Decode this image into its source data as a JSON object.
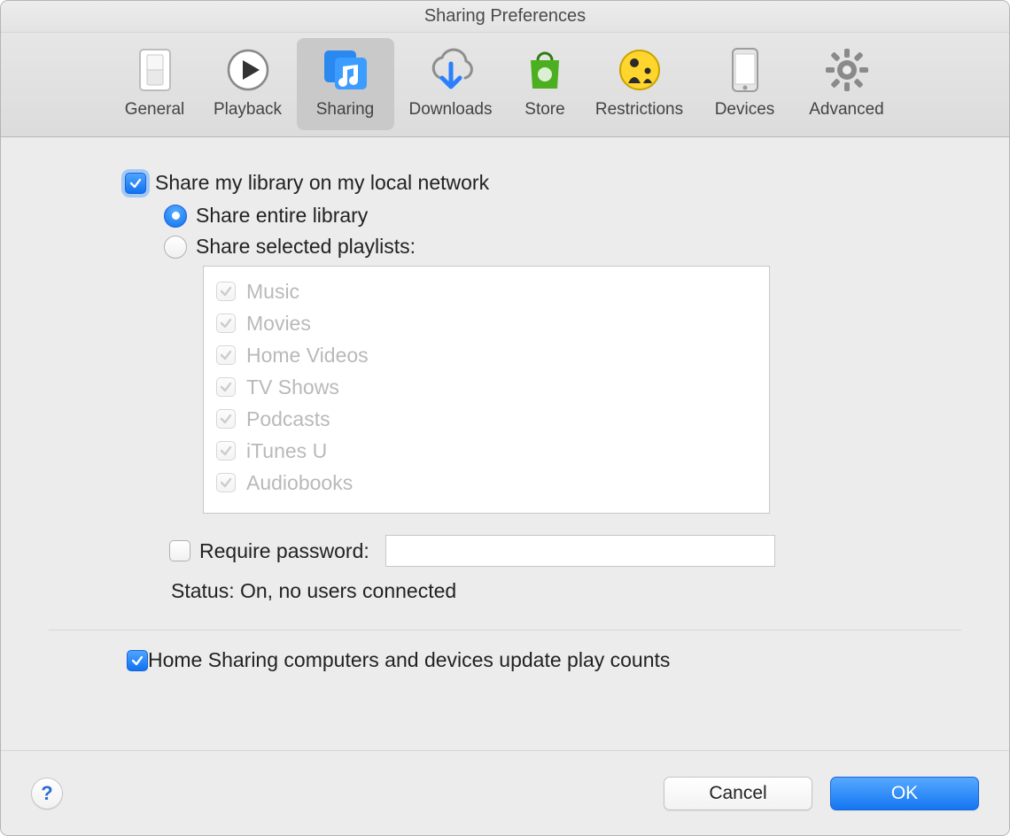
{
  "window": {
    "title": "Sharing Preferences"
  },
  "toolbar": {
    "items": [
      {
        "id": "general",
        "label": "General",
        "icon": "switch-icon",
        "active": false
      },
      {
        "id": "playback",
        "label": "Playback",
        "icon": "play-icon",
        "active": false
      },
      {
        "id": "sharing",
        "label": "Sharing",
        "icon": "music-share-icon",
        "active": true
      },
      {
        "id": "downloads",
        "label": "Downloads",
        "icon": "cloud-download-icon",
        "active": false
      },
      {
        "id": "store",
        "label": "Store",
        "icon": "shopping-bag-icon",
        "active": false
      },
      {
        "id": "restrictions",
        "label": "Restrictions",
        "icon": "parental-icon",
        "active": false
      },
      {
        "id": "devices",
        "label": "Devices",
        "icon": "phone-icon",
        "active": false
      },
      {
        "id": "advanced",
        "label": "Advanced",
        "icon": "gear-icon",
        "active": false
      }
    ]
  },
  "sharing": {
    "share_library": {
      "label": "Share my library on my local network",
      "checked": true
    },
    "mode": {
      "entire": {
        "label": "Share entire library",
        "selected": true
      },
      "selected": {
        "label": "Share selected playlists:",
        "selected": false
      }
    },
    "playlists": [
      {
        "label": "Music",
        "checked": true
      },
      {
        "label": "Movies",
        "checked": true
      },
      {
        "label": "Home Videos",
        "checked": true
      },
      {
        "label": "TV Shows",
        "checked": true
      },
      {
        "label": "Podcasts",
        "checked": true
      },
      {
        "label": "iTunes U",
        "checked": true
      },
      {
        "label": "Audiobooks",
        "checked": true
      }
    ],
    "require_password": {
      "label": "Require password:",
      "checked": false,
      "value": ""
    },
    "status_label": "Status: On, no users connected",
    "home_sharing": {
      "label": "Home Sharing computers and devices update play counts",
      "checked": true
    }
  },
  "footer": {
    "help": "?",
    "cancel": "Cancel",
    "ok": "OK"
  }
}
